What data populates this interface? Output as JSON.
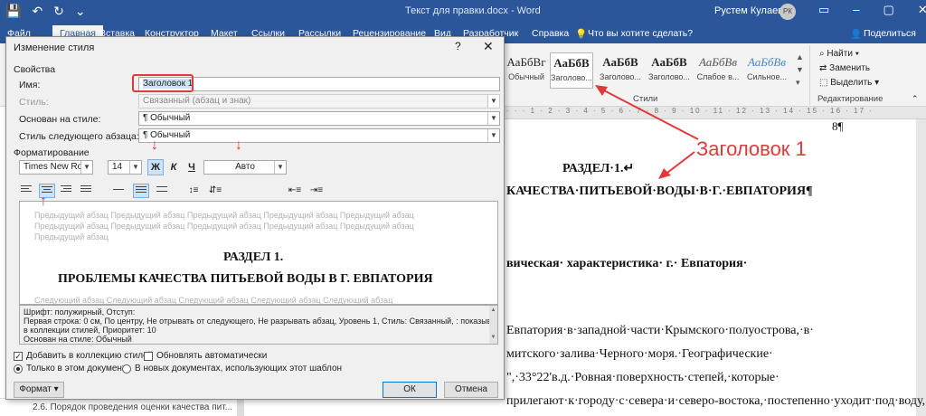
{
  "titlebar": {
    "doc_title": "Текст для правки.docx  -  Word",
    "user": "Рустем Кулаев",
    "initials": "РК",
    "icons": [
      "save-icon",
      "undo-icon",
      "redo-icon",
      "customize-icon"
    ]
  },
  "tabs": [
    "Файл",
    "Главная",
    "Вставка",
    "Конструктор",
    "Макет",
    "Ссылки",
    "Рассылки",
    "Рецензирование",
    "Вид",
    "Разработчик",
    "Справка",
    "Что вы хотите сделать?",
    "Поделиться"
  ],
  "ribbon": {
    "styles": [
      {
        "preview": "АаБбВг",
        "name": "Обычный"
      },
      {
        "preview": "АаБбВ",
        "name": "Заголово..."
      },
      {
        "preview": "АаБбВ",
        "name": "Заголово..."
      },
      {
        "preview": "АаБбВ",
        "name": "Заголово..."
      },
      {
        "preview": "АаБбВв",
        "name": "Слабое в..."
      },
      {
        "preview": "АаБбВв",
        "name": "Сильное..."
      }
    ],
    "styles_group": "Стили",
    "editing": {
      "find": "Найти",
      "replace": "Заменить",
      "select": "Выделить",
      "group": "Редактирование"
    }
  },
  "document": {
    "page_num": "8¶",
    "heading1": "РАЗДЕЛ·1.↵",
    "heading2": "КАЧЕСТВА·ПИТЬЕВОЙ·ВОДЫ·В·Г.·ЕВПАТОРИЯ¶",
    "line3": "вическая·          характеристика·          г.·          Евпатория·",
    "line4": "Евпатория·в·западной·части·Крымского·полуострова,·в·",
    "line5": "митского·залива·Черного·моря.·Географические·",
    "line6": "\",·33°22'в.д.·Ровная·поверхность·степей,·которые·",
    "line7": "прилегают·к·городу·с·севера·и·северо-востока,·постепенно·уходит·под·воду,·"
  },
  "annotation": "Заголовок 1",
  "nav_item": "2.6. Порядок проведения оценки качества пит...",
  "dialog": {
    "title": "Изменение стиля",
    "help": "?",
    "close": "✕",
    "props_section": "Свойства",
    "name_label": "Имя:",
    "name_value": "Заголовок 1",
    "style_label": "Стиль:",
    "style_value": "Связанный (абзац и знак)",
    "based_label": "Основан на стиле:",
    "based_value": "¶  Обычный",
    "next_label": "Стиль следующего абзаца:",
    "next_value": "¶  Обычный",
    "format_section": "Форматирование",
    "font": "Times New Roman",
    "size": "14",
    "bold": "Ж",
    "italic": "К",
    "underline": "Ч",
    "color": "Авто",
    "preview": {
      "prev_par1": "Предыдущий абзац Предыдущий абзац Предыдущий абзац Предыдущий абзац Предыдущий абзац",
      "prev_par2": "Предыдущий абзац",
      "heading1": "РАЗДЕЛ 1.",
      "heading2": "ПРОБЛЕМЫ КАЧЕСТВА ПИТЬЕВОЙ ВОДЫ В Г. ЕВПАТОРИЯ",
      "next_par": "Следующий абзац Следующий абзац Следующий абзац Следующий абзац Следующий абзац"
    },
    "description": [
      "Шрифт: полужирный, Отступ:",
      "    Первая строка:  0 см, По центру, Не отрывать от следующего, Не разрывать абзац, Уровень 1, Стиль: Связанный, : показывать",
      "    в коллекции стилей, Приоритет: 10",
      "    Основан на стиле: Обычный"
    ],
    "add_to_gallery": "Добавить в коллекцию стилей",
    "auto_update": "Обновлять автоматически",
    "only_doc": "Только в этом документе",
    "new_docs": "В новых документах, использующих этот шаблон",
    "format_btn": "Формат ▾",
    "ok": "ОК",
    "cancel": "Отмена"
  }
}
